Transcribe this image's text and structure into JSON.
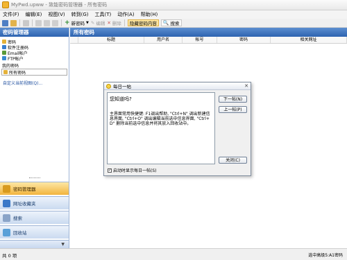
{
  "window": {
    "title": "MyPwd.upww - 致能密码管理器 - 所有密码"
  },
  "menu": [
    "文件(F)",
    "编辑(E)",
    "视图(V)",
    "转到(G)",
    "工具(T)",
    "动作(A)",
    "帮助(H)"
  ],
  "toolbar": {
    "new_password": "新密码",
    "edit": "编辑",
    "delete": "删除",
    "hide_password": "隐藏密码内容",
    "search": "搜索"
  },
  "sidebar": {
    "header": "密码管理器",
    "tree": [
      "密码",
      "软件注册码",
      "Email帐户",
      "FTP帐户"
    ],
    "my_passwords": "我的密码",
    "all_passwords": "所有密码",
    "custom_query": "自定义当前视图(Q)...",
    "nav": [
      "密码管理器",
      "网址收藏夹",
      "搜索",
      "回收站"
    ]
  },
  "main": {
    "header": "所有密码",
    "columns": [
      "标题",
      "用户名",
      "帐号",
      "密码",
      "相关网址"
    ]
  },
  "dialog": {
    "title": "每日一帖",
    "heading": "您知道吗?",
    "text": "主界面常用快捷键: F1调出帮助, \"Ctrl+N\" 调出新建信息界面, \"Ctrl+O\" 调出编辑当前选中信息界面, \"Ctrl+D\" 删除当前选中信息并将其放入回收站中。",
    "next_tip": "下一帖(N)",
    "prev_tip": "上一帖(P)",
    "close": "关闭(C)",
    "show_on_startup": "启动时显示每日一帖(S)",
    "show_on_startup_checked": true
  },
  "status": {
    "left": "共 0 项",
    "right": "选中高级5:A1密码"
  }
}
